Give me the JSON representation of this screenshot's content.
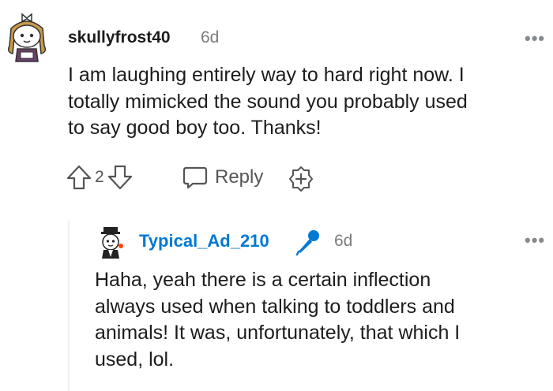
{
  "comment": {
    "username": "skullyfrost40",
    "age": "6d",
    "more": "•••",
    "text_lines": [
      "I am laughing entirely way to hard right now. I",
      "totally mimicked the sound you probably used",
      "to say good boy too. Thanks!"
    ],
    "score": "2",
    "reply_label": "Reply"
  },
  "reply": {
    "username": "Typical_Ad_210",
    "age": "6d",
    "more": "•••",
    "text_lines": [
      "Haha, yeah there is a certain inflection",
      "always used when talking to toddlers and",
      "animals! It was, unfortunately, that which I",
      "used, lol."
    ]
  },
  "colors": {
    "accent": "#0079d3",
    "muted": "#7c7c7c",
    "icon": "#555555"
  }
}
